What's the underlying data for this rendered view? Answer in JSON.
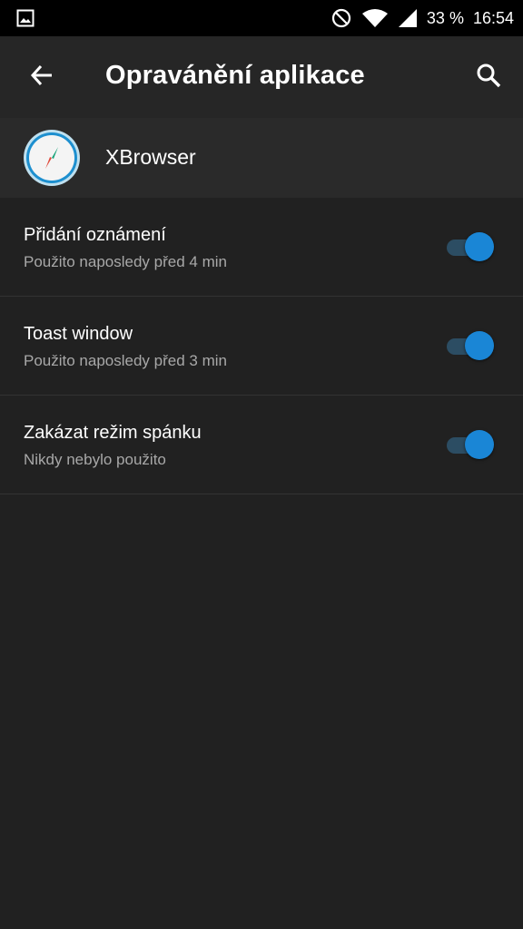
{
  "status_bar": {
    "battery": "33 %",
    "time": "16:54",
    "icons": [
      "image-icon",
      "do-not-disturb-icon",
      "wifi-icon",
      "signal-icon"
    ]
  },
  "app_bar": {
    "title": "Opravánění aplikace",
    "back_icon": "arrow-back-icon",
    "search_icon": "search-icon"
  },
  "app": {
    "name": "XBrowser",
    "icon": "compass-icon"
  },
  "permissions": [
    {
      "title": "Přidání oznámení",
      "subtitle": "Použito naposledy před 4 min",
      "enabled": true
    },
    {
      "title": "Toast window",
      "subtitle": "Použito naposledy před 3 min",
      "enabled": true
    },
    {
      "title": "Zakázat režim spánku",
      "subtitle": "Nikdy nebylo použito",
      "enabled": true
    }
  ],
  "colors": {
    "background": "#212121",
    "accent": "#1a86d6",
    "track": "#2c4d63"
  }
}
